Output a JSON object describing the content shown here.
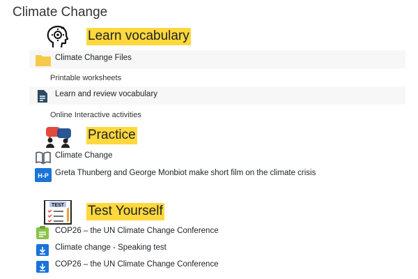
{
  "page": {
    "title": "Climate Change"
  },
  "sections": [
    {
      "heading": "Learn vocabulary",
      "icon": "head-gear-icon"
    },
    {
      "heading": "Practice",
      "icon": "people-talking-icon"
    },
    {
      "heading": "Test Yourself",
      "icon": "test-checklist-icon",
      "badge_text": "TEST"
    }
  ],
  "vocab": {
    "folder": {
      "label": "Climate Change Files",
      "icon": "folder-icon"
    },
    "printable_label": "Printable worksheets",
    "review": {
      "label": "Learn and review vocabulary",
      "icon": "document-icon"
    },
    "online_label": "Online Interactive activities"
  },
  "practice": {
    "book": {
      "label": "Climate Change",
      "icon": "book-icon"
    },
    "h5p": {
      "label": "Greta Thunberg and George Monbiot make short film on the climate crisis",
      "icon": "h5p-icon",
      "icon_text": "H-P"
    }
  },
  "test": {
    "items": [
      {
        "label": "COP26 – the UN Climate Change Conference",
        "icon": "assignment-icon"
      },
      {
        "label": "Climate change - Speaking test",
        "icon": "download-icon"
      },
      {
        "label": "COP26 – the UN Climate Change Conference",
        "icon": "download-icon"
      }
    ]
  },
  "colors": {
    "highlight": "#ffd83d",
    "folder": "#f7c948",
    "doc": "#2b4a62",
    "h5p": "#1a73d9",
    "assignment": "#8bc34a",
    "download": "#1a73d9"
  }
}
